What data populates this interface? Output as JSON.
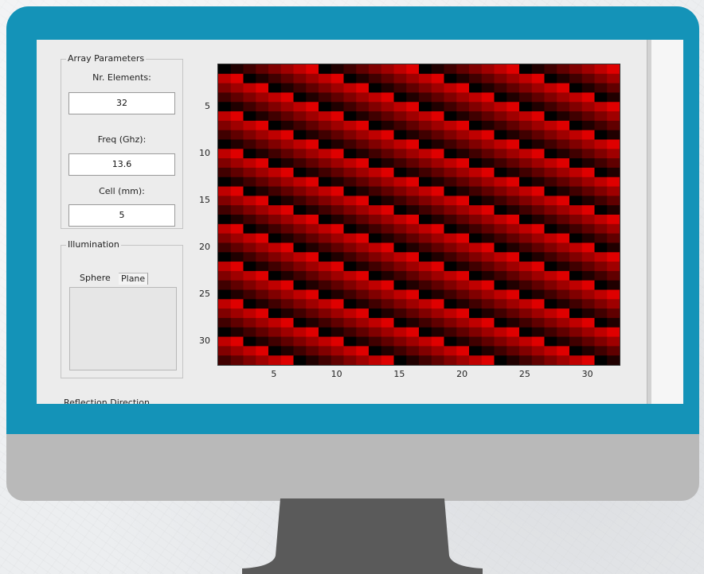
{
  "colors": {
    "frame": "#1493b8",
    "chin": "#b9b9b9",
    "stand": "#5a5a5a",
    "heat_low": "#000000",
    "heat_high": "#ff0000"
  },
  "array_parameters": {
    "title": "Array Parameters",
    "nr_elements_label": "Nr. Elements:",
    "nr_elements_value": "32",
    "freq_label": "Freq (Ghz):",
    "freq_value": "13.6",
    "cell_label": "Cell (mm):",
    "cell_value": "5"
  },
  "illumination": {
    "title": "Illumination",
    "tabs": [
      "Sphere",
      "Plane"
    ],
    "active_tab": "Plane"
  },
  "reflection_direction": {
    "title": "Reflection Direction"
  },
  "chart_data": {
    "type": "heatmap",
    "rows": 32,
    "cols": 32,
    "colormap": [
      "#000000",
      "#ff0000"
    ],
    "phase_step_per_col": 0.125,
    "phase_step_per_row": -0.25,
    "xticks": [
      "5",
      "10",
      "15",
      "20",
      "25",
      "30"
    ],
    "xtick_values": [
      5,
      10,
      15,
      20,
      25,
      30
    ],
    "yticks": [
      "5",
      "10",
      "15",
      "20",
      "25",
      "30"
    ],
    "ytick_values": [
      5,
      10,
      15,
      20,
      25,
      30
    ],
    "xlim": [
      0.5,
      32.5
    ],
    "ylim": [
      0.5,
      32.5
    ],
    "y_direction": "top-down"
  }
}
